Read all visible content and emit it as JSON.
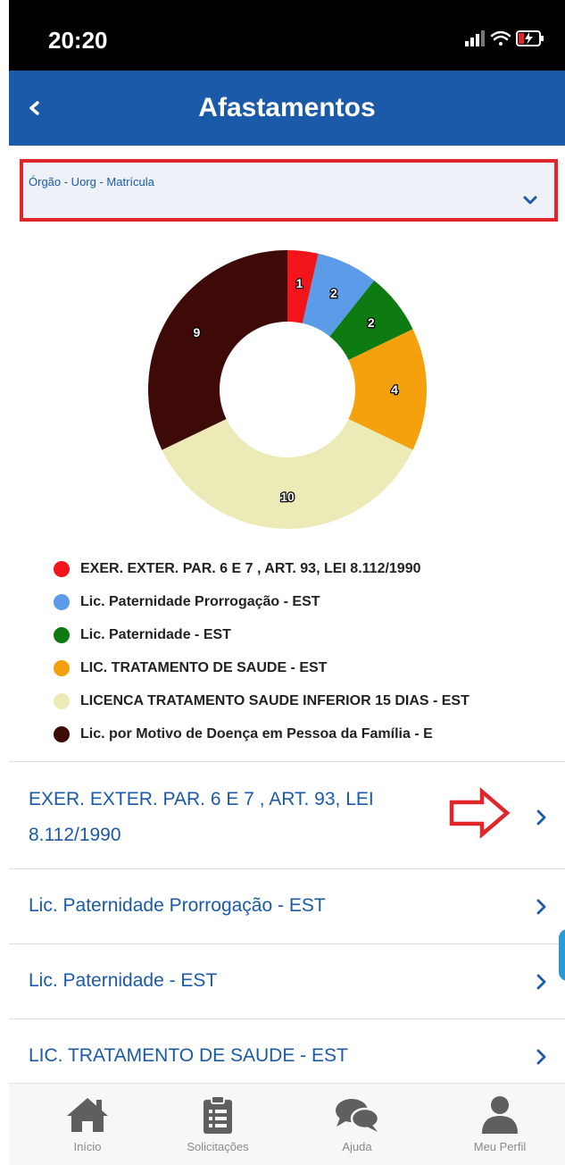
{
  "status_bar": {
    "time": "20:20"
  },
  "header": {
    "title": "Afastamentos"
  },
  "selector": {
    "label": "Órgão - Uorg - Matrícula"
  },
  "chart_data": {
    "type": "pie",
    "categories": [
      "EXER. EXTER. PAR. 6 E 7 , ART. 93, LEI 8.112/1990",
      "Lic. Paternidade Prorrogação - EST",
      "Lic. Paternidade - EST",
      "LIC. TRATAMENTO DE SAUDE - EST",
      "LICENCA TRATAMENTO SAUDE INFERIOR 15 DIAS - EST",
      "Lic. por Motivo de Doença em Pessoa da Família - E"
    ],
    "values": [
      1,
      2,
      2,
      4,
      10,
      9
    ],
    "colors": [
      "#f2141b",
      "#5b9be8",
      "#0e7a12",
      "#f5a10d",
      "#ecebb7",
      "#3d0a07"
    ],
    "donut": true,
    "legend_position": "bottom"
  },
  "legend": [
    {
      "label": "EXER. EXTER. PAR. 6 E 7 , ART. 93, LEI 8.112/1990",
      "color": "#f2141b"
    },
    {
      "label": "Lic. Paternidade Prorrogação - EST",
      "color": "#5b9be8"
    },
    {
      "label": "Lic. Paternidade - EST",
      "color": "#0e7a12"
    },
    {
      "label": "LIC. TRATAMENTO DE SAUDE - EST",
      "color": "#f5a10d"
    },
    {
      "label": "LICENCA TRATAMENTO SAUDE INFERIOR 15 DIAS - EST",
      "color": "#ecebb7"
    },
    {
      "label": "Lic. por Motivo de Doença em Pessoa da Família - E",
      "color": "#3d0a07"
    }
  ],
  "list": {
    "items": [
      {
        "line1": "EXER. EXTER. PAR. 6  E 7 , ART. 93, LEI",
        "line2": "8.112/1990"
      },
      {
        "line1": "Lic. Paternidade Prorrogação - EST"
      },
      {
        "line1": "Lic. Paternidade - EST"
      },
      {
        "line1": "LIC. TRATAMENTO DE SAUDE - EST"
      }
    ]
  },
  "tabs": [
    {
      "label": "Início",
      "icon": "home-icon"
    },
    {
      "label": "Solicitações",
      "icon": "clipboard-icon"
    },
    {
      "label": "Ajuda",
      "icon": "chat-bubbles-icon"
    },
    {
      "label": "Meu Perfil",
      "icon": "user-icon"
    }
  ],
  "theme": {
    "primary": "#1a5aa8",
    "annotation": "#e0262b"
  }
}
